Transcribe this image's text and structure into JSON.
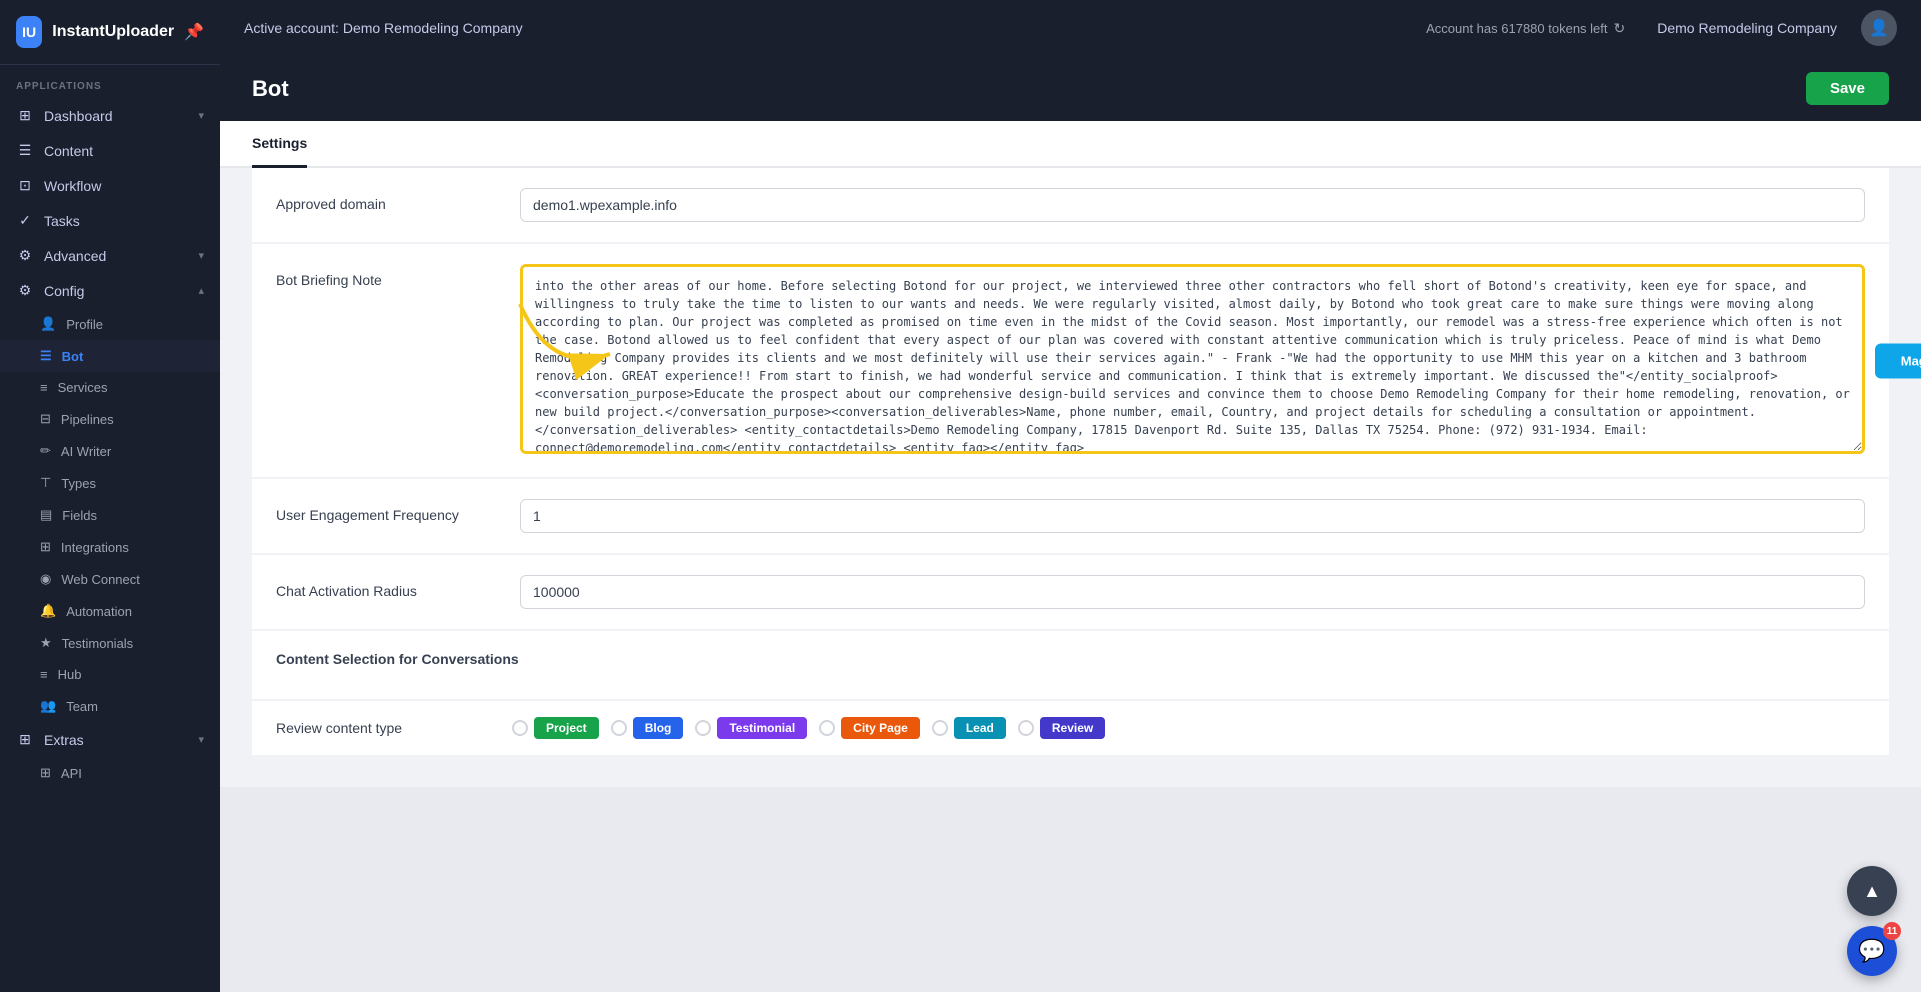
{
  "app": {
    "name": "InstantUploader",
    "logo_letter": "IU"
  },
  "topbar": {
    "active_account": "Active account: Demo Remodeling Company",
    "tokens_label": "Account has 617880 tokens left",
    "company_name": "Demo Remodeling Company"
  },
  "sidebar": {
    "section_label": "APPLICATIONS",
    "items": [
      {
        "id": "dashboard",
        "label": "Dashboard",
        "icon": "⊞",
        "has_chevron": true
      },
      {
        "id": "content",
        "label": "Content",
        "icon": "☰",
        "has_chevron": false
      },
      {
        "id": "workflow",
        "label": "Workflow",
        "icon": "⊡",
        "has_chevron": false
      },
      {
        "id": "tasks",
        "label": "Tasks",
        "icon": "✓",
        "has_chevron": false
      }
    ],
    "sub_items": [
      {
        "id": "advanced",
        "label": "Advanced",
        "icon": "⚙",
        "has_chevron": true
      },
      {
        "id": "config",
        "label": "Config",
        "icon": "⚙",
        "has_chevron": true,
        "expanded": true
      },
      {
        "id": "profile",
        "label": "Profile",
        "icon": "👤",
        "indent": true
      },
      {
        "id": "bot",
        "label": "Bot",
        "icon": "☰",
        "indent": true,
        "active": true
      },
      {
        "id": "services",
        "label": "Services",
        "icon": "≡",
        "indent": true
      },
      {
        "id": "pipelines",
        "label": "Pipelines",
        "icon": "⊟",
        "indent": true
      },
      {
        "id": "ai-writer",
        "label": "AI Writer",
        "icon": "✏",
        "indent": true
      },
      {
        "id": "types",
        "label": "Types",
        "icon": "⊤",
        "indent": true
      },
      {
        "id": "fields",
        "label": "Fields",
        "icon": "▤",
        "indent": true
      },
      {
        "id": "integrations",
        "label": "Integrations",
        "icon": "⊞",
        "indent": true
      },
      {
        "id": "web-connect",
        "label": "Web Connect",
        "icon": "◉",
        "indent": true
      },
      {
        "id": "automation",
        "label": "Automation",
        "icon": "🔔",
        "indent": true
      },
      {
        "id": "testimonials",
        "label": "Testimonials",
        "icon": "★",
        "indent": true
      },
      {
        "id": "hub",
        "label": "Hub",
        "icon": "≡",
        "indent": true
      },
      {
        "id": "team",
        "label": "Team",
        "icon": "👥",
        "indent": true
      }
    ],
    "extras": [
      {
        "id": "extras",
        "label": "Extras",
        "icon": "⊞",
        "has_chevron": true
      },
      {
        "id": "api",
        "label": "API",
        "icon": "⊞",
        "indent": true
      }
    ]
  },
  "page": {
    "title": "Bot",
    "save_button": "Save"
  },
  "tabs": [
    {
      "id": "settings",
      "label": "Settings",
      "active": true
    }
  ],
  "form": {
    "approved_domain_label": "Approved domain",
    "approved_domain_value": "demo1.wpexample.info",
    "bot_briefing_label": "Bot Briefing Note",
    "bot_briefing_text": "into the other areas of our home. Before selecting Botond for our project, we interviewed three other contractors who fell short of Botond's creativity, keen eye for space, and willingness to truly take the time to listen to our wants and needs. We were regularly visited, almost daily, by Botond who took great care to make sure things were moving along according to plan. Our project was completed as promised on time even in the midst of the Covid season. Most importantly, our remodel was a stress-free experience which often is not the case. Botond allowed us to feel confident that every aspect of our plan was covered with constant attentive communication which is truly priceless. Peace of mind is what Demo Remodeling Company provides its clients and we most definitely will use their services again.\" - Frank -\"We had the opportunity to use MHM this year on a kitchen and 3 bathroom renovation. GREAT experience!! From start to finish, we had wonderful service and communication. I think that is extremely important. We discussed the\"</entity_socialproof><conversation_purpose>Educate the prospect about our comprehensive design-build services and convince them to choose Demo Remodeling Company for their home remodeling, renovation, or new build project.</conversation_purpose><conversation_deliverables>Name, phone number, email, Country, and project details for scheduling a consultation or appointment.</conversation_deliverables> <entity_contactdetails>Demo Remodeling Company, 17815 Davenport Rd. Suite 135, Dallas TX 75254. Phone: (972) 931-1934. Email: connect@demoremodeling.com</entity_contactdetails> <entity_faq></entity_faq>",
    "user_engagement_label": "User Engagement Frequency",
    "user_engagement_value": "1",
    "chat_activation_label": "Chat Activation Radius",
    "chat_activation_value": "100000",
    "content_selection_label": "Content Selection for Conversations",
    "review_content_label": "Review content type",
    "magically_generate_label": "Magically Generate"
  },
  "review_badges": [
    {
      "id": "project",
      "label": "Project",
      "color": "green"
    },
    {
      "id": "blog",
      "label": "Blog",
      "color": "blue"
    },
    {
      "id": "testimonial",
      "label": "Testimonial",
      "color": "purple"
    },
    {
      "id": "city-page",
      "label": "City Page",
      "color": "orange"
    },
    {
      "id": "lead",
      "label": "Lead",
      "color": "teal"
    },
    {
      "id": "review",
      "label": "Review",
      "color": "indigo"
    }
  ],
  "notification_count": "11"
}
